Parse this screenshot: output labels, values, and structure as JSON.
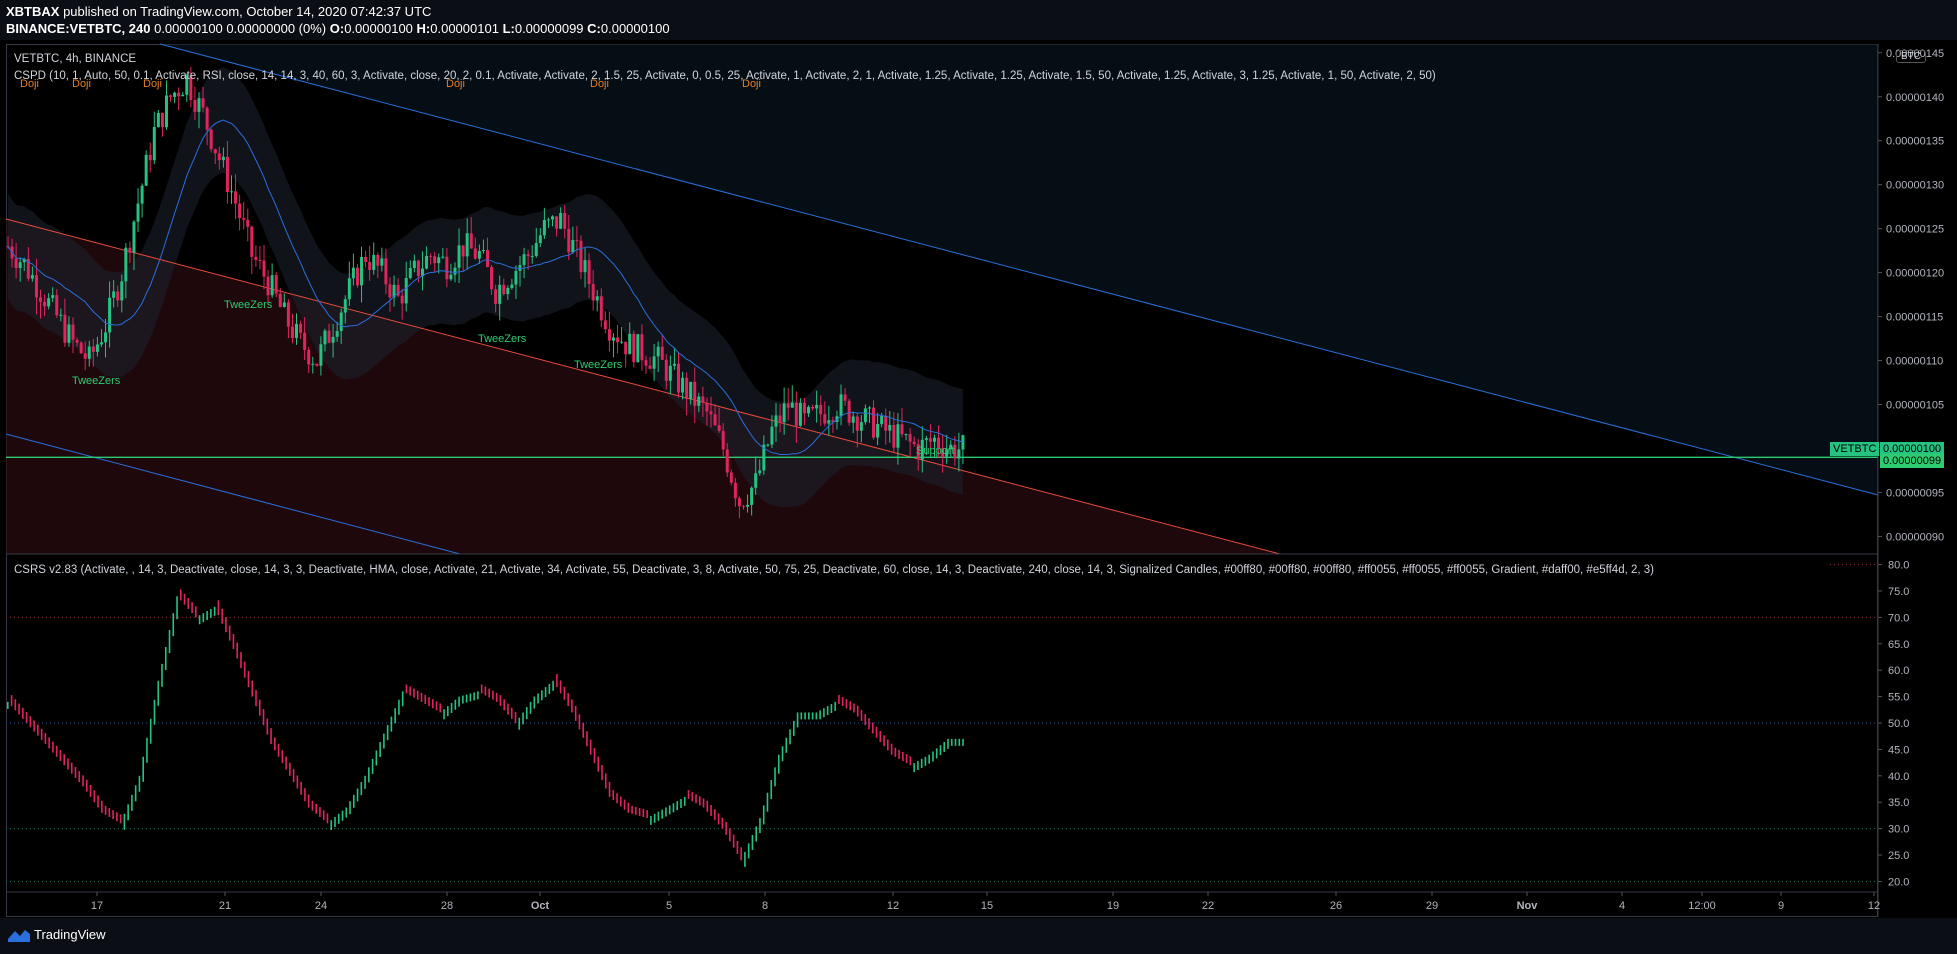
{
  "header": {
    "publisher": "XBTBAX",
    "published_text": "published on TradingView.com, October 14, 2020 07:42:37 UTC",
    "symbol": "BINANCE:VETBTC, 240",
    "ohlc_text": "0.00000100 0.00000000 (0%)",
    "o_label": "O:",
    "o_val": "0.00000100",
    "h_label": "H:",
    "h_val": "0.00000101",
    "l_label": "L:",
    "l_val": "0.00000099",
    "c_label": "C:",
    "c_val": "0.00000100"
  },
  "main_pane": {
    "title": "VETBTC, 4h, BINANCE",
    "indicator": "CSPD (10, 1, Auto, 50, 0.1, Activate, RSI, close, 14, 14, 3, 40, 60, 3, Activate, close, 20, 2, 0.1, Activate, Activate, 2, 1.5, 25, Activate, 0, 0.5, 25, Activate, 1, Activate, 2, 1, Activate, 1.25, Activate, 1.25, Activate, 1.5, 50, Activate, 1.25, Activate, 3, 1.25, Activate, 1, 50, Activate, 2, 50)",
    "currency_badge": "BTC",
    "price_label_name": "VETBTC",
    "price_label_value": "0.00000100",
    "line_label_value": "0.00000099",
    "support_label": "Support",
    "doji_label": "Doji",
    "tweezers_label": "TweeZers"
  },
  "sub_pane": {
    "indicator": "CSRS v2.83 (Activate, , 14, 3, Deactivate, close, 14, 3, 3, Deactivate, HMA, close, Activate, 21, Activate, 34, Activate, 55, Deactivate, 3, 8, Activate, 50, 75, 25, Deactivate, 60, close, 14, 3, Deactivate, 240, close, 14, 3, Signalized Candles, #00ff80, #00ff80, #00ff80, #ff0055, #ff0055, #ff0055, Gradient, #daff00, #e5ff4d, 2, 3)"
  },
  "footer": {
    "brand": "TradingView"
  },
  "colors": {
    "up": "#26c281",
    "down": "#e0245e",
    "channel": "#2a6fdb",
    "trend_red": "#e74c3c",
    "support": "#2ecc71",
    "bg": "#000000"
  },
  "chart_data": [
    {
      "type": "candlestick",
      "title": "VETBTC, 4h, BINANCE",
      "ylim": [
        8.8e-07,
        1.46e-06
      ],
      "y_ticks": [
        "0.00000145",
        "0.00000140",
        "0.00000135",
        "0.00000130",
        "0.00000125",
        "0.00000120",
        "0.00000115",
        "0.00000110",
        "0.00000105",
        "0.00000100",
        "0.00000095",
        "0.00000090"
      ],
      "x_ticks": [
        "17",
        "21",
        "24",
        "28",
        "Oct",
        "5",
        "8",
        "12",
        "15",
        "19",
        "22",
        "26",
        "29",
        "Nov",
        "4",
        "12:00",
        "9",
        "12"
      ],
      "close_path": [
        1.23,
        1.21,
        1.18,
        1.15,
        1.12,
        1.1,
        1.14,
        1.2,
        1.28,
        1.36,
        1.4,
        1.42,
        1.38,
        1.33,
        1.28,
        1.22,
        1.19,
        1.15,
        1.12,
        1.1,
        1.14,
        1.18,
        1.22,
        1.2,
        1.17,
        1.2,
        1.22,
        1.21,
        1.23,
        1.22,
        1.18,
        1.2,
        1.22,
        1.25,
        1.26,
        1.22,
        1.18,
        1.14,
        1.12,
        1.11,
        1.1,
        1.08,
        1.06,
        1.04,
        1.0,
        0.94,
        0.96,
        1.02,
        1.05,
        1.03,
        1.04,
        1.05,
        1.04,
        1.03,
        1.02,
        1.01,
        1.0,
        1.01,
        1.0
      ],
      "current_price": 1e-06,
      "support_level": 9.9e-07
    },
    {
      "type": "bar",
      "title": "CSRS v2.83",
      "ylim": [
        18,
        82
      ],
      "y_ticks": [
        "80.0",
        "75.0",
        "70.0",
        "65.0",
        "60.0",
        "55.0",
        "50.0",
        "45.0",
        "40.0",
        "35.0",
        "30.0",
        "25.0",
        "20.0"
      ],
      "reference_levels": [
        70,
        50,
        30,
        20
      ],
      "rsi_path": [
        54,
        50,
        46,
        42,
        38,
        33,
        31,
        40,
        58,
        74,
        70,
        72,
        64,
        55,
        46,
        40,
        34,
        31,
        34,
        40,
        48,
        56,
        54,
        52,
        55,
        56,
        54,
        50,
        55,
        58,
        52,
        44,
        36,
        33,
        32,
        34,
        36,
        34,
        30,
        24,
        32,
        44,
        52,
        52,
        54,
        52,
        48,
        44,
        42,
        44,
        47
      ]
    }
  ]
}
